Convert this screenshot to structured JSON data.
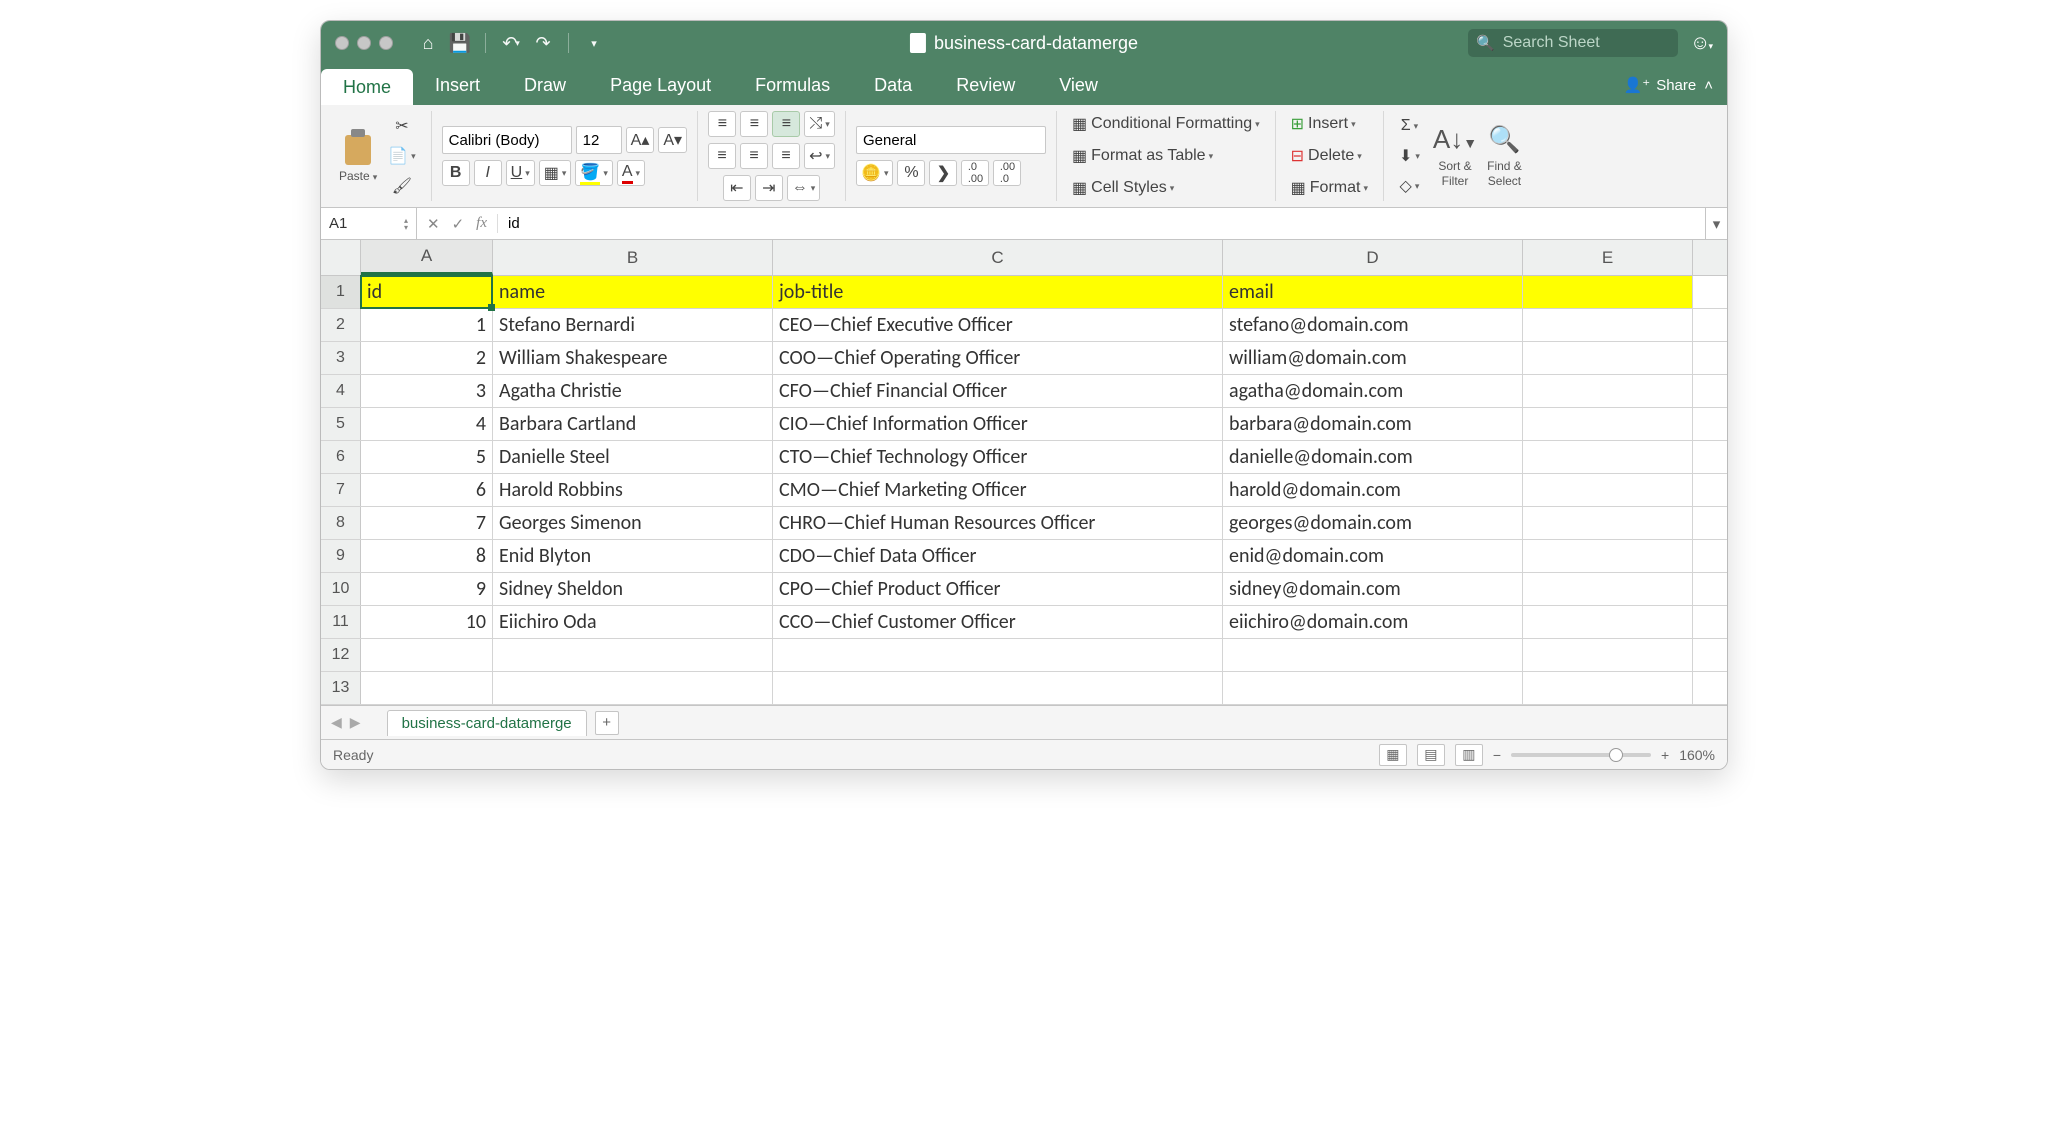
{
  "title": "business-card-datamerge",
  "search_placeholder": "Search Sheet",
  "share_label": "Share",
  "tabs": [
    "Home",
    "Insert",
    "Draw",
    "Page Layout",
    "Formulas",
    "Data",
    "Review",
    "View"
  ],
  "active_tab": "Home",
  "clipboard": {
    "paste_label": "Paste"
  },
  "font": {
    "name": "Calibri (Body)",
    "size": "12"
  },
  "number_format": "General",
  "styles_group": {
    "cond_format": "Conditional Formatting",
    "format_table": "Format as Table",
    "cell_styles": "Cell Styles"
  },
  "cells_group": {
    "insert": "Insert",
    "delete": "Delete",
    "format": "Format"
  },
  "editing_group": {
    "sort_filter": "Sort &\nFilter",
    "find_select": "Find &\nSelect"
  },
  "namebox": "A1",
  "formula_value": "id",
  "columns": [
    "A",
    "B",
    "C",
    "D",
    "E"
  ],
  "headers": {
    "A": "id",
    "B": "name",
    "C": "job-title",
    "D": "email"
  },
  "data_rows": [
    {
      "id": "1",
      "name": "Stefano Bernardi",
      "title": "CEO—Chief Executive Officer",
      "email": "stefano@domain.com"
    },
    {
      "id": "2",
      "name": "William Shakespeare",
      "title": "COO—Chief Operating Officer",
      "email": "william@domain.com"
    },
    {
      "id": "3",
      "name": "Agatha Christie",
      "title": "CFO—Chief Financial Officer",
      "email": "agatha@domain.com"
    },
    {
      "id": "4",
      "name": "Barbara Cartland",
      "title": "CIO—Chief Information Officer",
      "email": "barbara@domain.com"
    },
    {
      "id": "5",
      "name": "Danielle Steel",
      "title": "CTO—Chief Technology Officer",
      "email": "danielle@domain.com"
    },
    {
      "id": "6",
      "name": "Harold Robbins",
      "title": "CMO—Chief Marketing Officer",
      "email": "harold@domain.com"
    },
    {
      "id": "7",
      "name": "Georges Simenon",
      "title": "CHRO—Chief Human Resources Officer",
      "email": "georges@domain.com"
    },
    {
      "id": "8",
      "name": "Enid Blyton",
      "title": "CDO—Chief Data Officer",
      "email": "enid@domain.com"
    },
    {
      "id": "9",
      "name": "Sidney Sheldon",
      "title": "CPO—Chief Product Officer",
      "email": "sidney@domain.com"
    },
    {
      "id": "10",
      "name": "Eiichiro Oda",
      "title": "CCO—Chief Customer Officer",
      "email": "eiichiro@domain.com"
    }
  ],
  "empty_rows": 2,
  "sheet_name": "business-card-datamerge",
  "status_text": "Ready",
  "zoom": "160%"
}
